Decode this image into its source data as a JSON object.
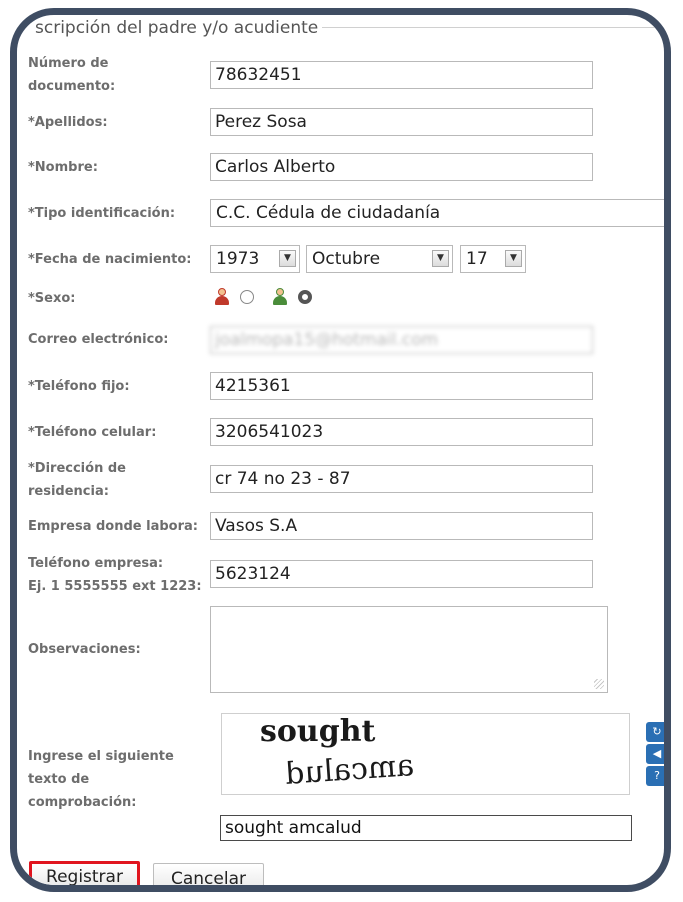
{
  "legend": "scripción del padre y/o acudiente",
  "fields": {
    "documento": {
      "label_line1": "Número de",
      "label_line2": "documento:",
      "value": "78632451"
    },
    "apellidos": {
      "label": "*Apellidos:",
      "value": "Perez Sosa"
    },
    "nombre": {
      "label": "*Nombre:",
      "value": "Carlos Alberto"
    },
    "tipo_id": {
      "label": "*Tipo identificación:",
      "value": "C.C. Cédula de ciudadanía"
    },
    "fecha": {
      "label": "*Fecha de nacimiento:",
      "year": "1973",
      "month": "Octubre",
      "day": "17"
    },
    "sexo": {
      "label": "*Sexo:",
      "selected": "male"
    },
    "correo": {
      "label": "Correo electrónico:",
      "value": "joalmopa15@hotmail.com"
    },
    "tel_fijo": {
      "label": "*Teléfono fijo:",
      "value": "4215361"
    },
    "tel_celular": {
      "label": "*Teléfono celular:",
      "value": "3206541023"
    },
    "direccion": {
      "label_line1": "*Dirección de",
      "label_line2": "residencia:",
      "value": "cr 74 no 23 - 87"
    },
    "empresa": {
      "label": "Empresa donde labora:",
      "value": "Vasos S.A"
    },
    "tel_empresa": {
      "label_line1": "Teléfono empresa:",
      "label_line2": "Ej. 1 5555555 ext 1223:",
      "value": "5623124"
    },
    "observaciones": {
      "label": "Observaciones:",
      "value": ""
    },
    "captcha": {
      "label_line1": "Ingrese el siguiente",
      "label_line2": "texto de",
      "label_line3": "comprobación:",
      "word1": "sought",
      "word2": "amcalud",
      "value": "sought amcalud"
    }
  },
  "buttons": {
    "register": "Registrar",
    "cancel": "Cancelar"
  },
  "colors": {
    "frame": "#3f4d63",
    "highlight": "#e0141e",
    "female_icon": "#c0392b",
    "male_icon": "#4a8c3a",
    "captcha_tools": "#2a6fb4"
  }
}
